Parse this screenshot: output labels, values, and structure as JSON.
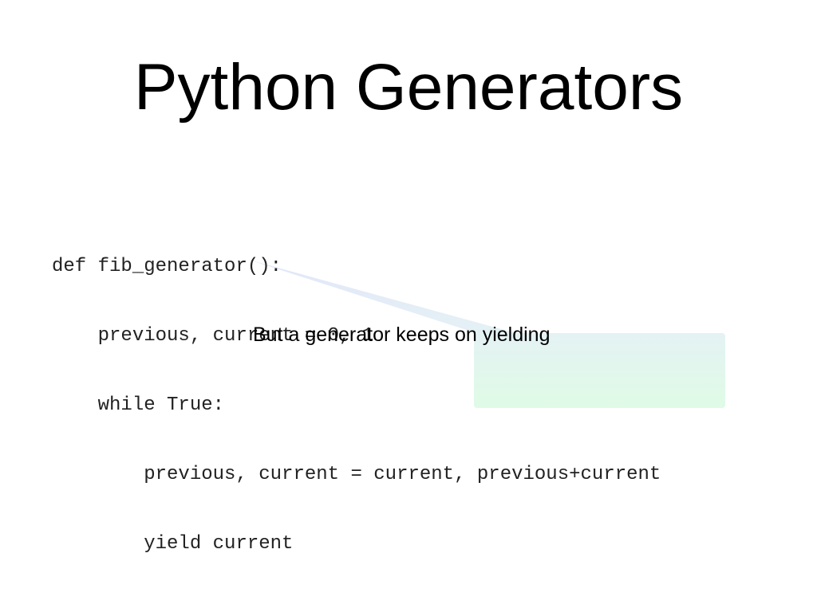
{
  "slide": {
    "title": "Python Generators",
    "code_lines": [
      "def fib_generator():",
      "    previous, current = 0, 1",
      "    while True:",
      "        previous, current = current, previous+current",
      "        yield current"
    ],
    "callout": {
      "text": "But a generator keeps on yielding",
      "fill_top": "#e4f2f4",
      "fill_bottom": "#dffbe6",
      "pointer_color": "#dde4f8"
    }
  }
}
